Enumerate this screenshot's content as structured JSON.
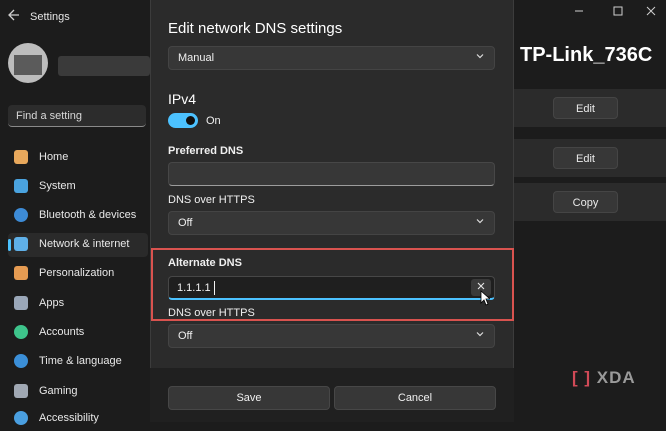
{
  "window": {
    "app_title": "Settings",
    "back_icon": "arrow-left-icon",
    "controls": [
      "minimize-icon",
      "maximize-icon",
      "close-icon"
    ]
  },
  "search": {
    "placeholder": "Find a setting"
  },
  "sidebar": {
    "items": [
      {
        "label": "Home",
        "icon": "home-icon",
        "color": "#e8a85c"
      },
      {
        "label": "System",
        "icon": "system-icon",
        "color": "#4aa3df"
      },
      {
        "label": "Bluetooth & devices",
        "icon": "bluetooth-icon",
        "color": "#3d8bd6"
      },
      {
        "label": "Network & internet",
        "icon": "wifi-icon",
        "color": "#5fb0e8",
        "active": true
      },
      {
        "label": "Personalization",
        "icon": "brush-icon",
        "color": "#e59b52"
      },
      {
        "label": "Apps",
        "icon": "apps-icon",
        "color": "#9aa7b8"
      },
      {
        "label": "Accounts",
        "icon": "person-icon",
        "color": "#3ec48b"
      },
      {
        "label": "Time & language",
        "icon": "globe-clock-icon",
        "color": "#3b8fd8"
      },
      {
        "label": "Gaming",
        "icon": "gamepad-icon",
        "color": "#a0a8b3"
      },
      {
        "label": "Accessibility",
        "icon": "accessibility-icon",
        "color": "#4a9fe0"
      }
    ]
  },
  "main": {
    "heading": "TP-Link_736C",
    "buttons": [
      "Edit",
      "Edit",
      "Copy"
    ]
  },
  "dialog": {
    "title": "Edit network DNS settings",
    "mode_select": "Manual",
    "section": "IPv4",
    "toggle_label": "On",
    "preferred_dns_label": "Preferred DNS",
    "preferred_dns_value": "",
    "doh_label_1": "DNS over HTTPS",
    "doh_value_1": "Off",
    "alternate_dns_label": "Alternate DNS",
    "alternate_dns_value": "1.1.1.1",
    "doh_label_2": "DNS over HTTPS",
    "doh_value_2": "Off",
    "save_label": "Save",
    "cancel_label": "Cancel"
  },
  "watermark": {
    "brand": "XDA",
    "bracket": "[ ]"
  },
  "colors": {
    "accent": "#4cc2ff",
    "highlight_box": "#d9534f"
  }
}
